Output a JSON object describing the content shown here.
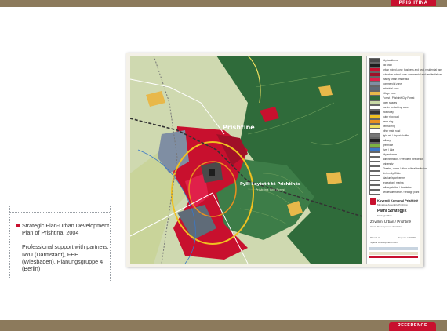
{
  "header": {
    "tab_label": "PRISHTINA"
  },
  "footer": {
    "tab_label": "REFERENCE"
  },
  "caption": {
    "line1": "Strategic Plan-Urban Development",
    "line2": "Plan of Prishtina, 2004",
    "partners1": "Professional support with partners:",
    "partners2": "IWU (Darmstadt), FEH",
    "partners3": "(Wiesbaden), Planungsgruppe 4",
    "partners4": "(Berlin)"
  },
  "map": {
    "city_label": "Prishtinë",
    "forest_label": "Pylli i qytetit të Prishtinës",
    "forest_sublabel": "Prishtina City Forest"
  },
  "legend": {
    "items": [
      {
        "label": "city backbone",
        "color": "#4a4a4a"
      },
      {
        "label": "old town",
        "color": "#1e1e1e"
      },
      {
        "label": "urban mixed zone: business and sect. residential use",
        "color": "#c8102e"
      },
      {
        "label": "suburban mixed zone: commercial and residential use",
        "color": "#a01028"
      },
      {
        "label": "mainly urban residential",
        "color": "#e0204a"
      },
      {
        "label": "commercial zone",
        "color": "#7f8ea3"
      },
      {
        "label": "industrial zone",
        "color": "#5f6b78"
      },
      {
        "label": "village zone",
        "color": "#e8b84a"
      },
      {
        "label": "Forest / Prishtinë City Forest",
        "color": "#2f6b3a"
      },
      {
        "label": "open spaces",
        "color": "#c9d9a6"
      },
      {
        "label": "border for built-up area",
        "color": "#ffffff"
      },
      {
        "label": "motorway",
        "color": "#333333"
      },
      {
        "label": "outer ring road",
        "color": "#f0c020"
      },
      {
        "label": "inner ring",
        "color": "#e89020"
      },
      {
        "label": "central ring",
        "color": "#f0e060"
      },
      {
        "label": "other main road",
        "color": "#ffffff"
      },
      {
        "label": "light rail / airport shuttle",
        "color": "#777777"
      },
      {
        "label": "railway",
        "color": "#222222"
      },
      {
        "label": "greenline",
        "color": "#7cb342"
      },
      {
        "label": "river / lake",
        "color": "#3a78c8"
      },
      {
        "label": "city entrance",
        "color": "#ffffff"
      },
      {
        "label": "administration / President Residence",
        "color": "#ffffff"
      },
      {
        "label": "university",
        "color": "#ffffff"
      },
      {
        "label": "Theatre, opera / other cultural institution",
        "color": "#ffffff"
      },
      {
        "label": "University Clinic",
        "color": "#ffffff"
      },
      {
        "label": "stadium/sportcentre",
        "color": "#ffffff"
      },
      {
        "label": "recreation / marina",
        "color": "#ffffff"
      },
      {
        "label": "railway station / busstation",
        "color": "#ffffff"
      },
      {
        "label": "wholesale market / sewage plant",
        "color": "#ffffff"
      }
    ]
  },
  "title_block": {
    "org": "Kuvendi Komunal Prishtinë",
    "org_sub": "Municipal Assembly Prishtinë",
    "plan_title": "Plani Strategjik",
    "plan_sub": "Strategic Plan",
    "dev_title": "Zhvillimi Urban / Prishtinë",
    "dev_sub": "Urban Development / Prishtinë",
    "plan_no": "Plani 1.7",
    "scale": "Proporc: 1:20.000",
    "footer": "Spatial Development Plan"
  },
  "colors": {
    "brand_red": "#c8102e",
    "bar_brown": "#8c7a5c",
    "forest": "#2f6b3a",
    "urban": "#c8102e"
  }
}
